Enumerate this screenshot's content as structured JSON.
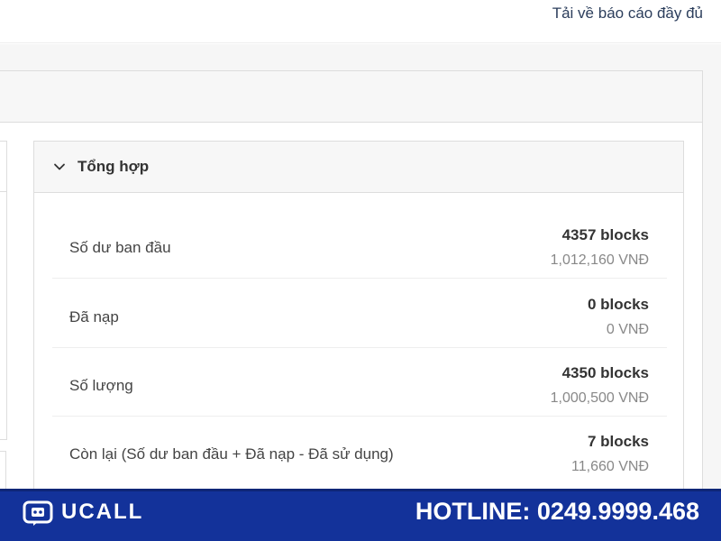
{
  "header": {
    "download_link": "Tải về báo cáo đầy đủ"
  },
  "summary": {
    "title": "Tổng hợp",
    "rows": [
      {
        "label": "Số dư ban đầu",
        "blocks": "4357 blocks",
        "vnd": "1,012,160 VNĐ"
      },
      {
        "label": "Đã nạp",
        "blocks": "0 blocks",
        "vnd": "0 VNĐ"
      },
      {
        "label": "Số lượng",
        "blocks": "4350 blocks",
        "vnd": "1,000,500 VNĐ"
      },
      {
        "label": "Còn lại (Số dư ban đầu + Đã nạp - Đã sử dụng)",
        "blocks": "7 blocks",
        "vnd": "11,660 VNĐ"
      }
    ]
  },
  "footer": {
    "brand": "UCALL",
    "hotline": "HOTLINE: 0249.9999.468",
    "background_color": "#13329a",
    "logo_icon": "chat-bot-icon"
  },
  "icons": {
    "summary_toggle": "chevron-down-icon"
  }
}
